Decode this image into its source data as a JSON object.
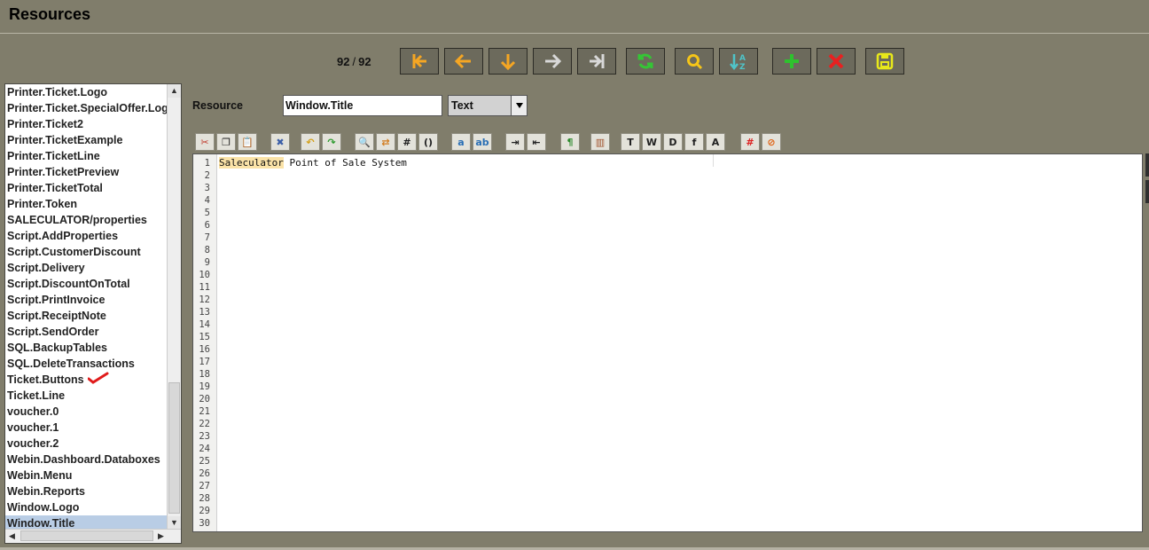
{
  "window": {
    "title": "Resources"
  },
  "record": {
    "current": "92",
    "separator": "/",
    "total": "92"
  },
  "nav_buttons": [
    {
      "name": "first-record-button",
      "icon": "first-icon",
      "color": "#f5a623"
    },
    {
      "name": "previous-record-button",
      "icon": "arrow-left-icon",
      "color": "#f5a623"
    },
    {
      "name": "down-record-button",
      "icon": "arrow-down-icon",
      "color": "#f5a623"
    },
    {
      "name": "next-record-button",
      "icon": "arrow-right-icon",
      "color": "#d8d8d8"
    },
    {
      "name": "last-record-button",
      "icon": "last-icon",
      "color": "#d8d8d8"
    },
    {
      "name": "refresh-button",
      "icon": "refresh-icon",
      "color": "#35c535"
    },
    {
      "name": "search-button",
      "icon": "search-icon",
      "color": "#f5c518"
    },
    {
      "name": "sort-button",
      "icon": "sort-az-icon",
      "color": "#4fc3c8"
    },
    {
      "name": "add-button",
      "icon": "plus-icon",
      "color": "#2ec22e"
    },
    {
      "name": "delete-button",
      "icon": "delete-x-icon",
      "color": "#e82020"
    },
    {
      "name": "save-button",
      "icon": "save-icon",
      "color": "#e8e81a"
    }
  ],
  "resource_list": {
    "items": [
      "Printer.Ticket.Logo",
      "Printer.Ticket.SpecialOffer.Logo",
      "Printer.Ticket2",
      "Printer.TicketExample",
      "Printer.TicketLine",
      "Printer.TicketPreview",
      "Printer.TicketTotal",
      "Printer.Token",
      "SALECULATOR/properties",
      "Script.AddProperties",
      "Script.CustomerDiscount",
      "Script.Delivery",
      "Script.DiscountOnTotal",
      "Script.PrintInvoice",
      "Script.ReceiptNote",
      "Script.SendOrder",
      "SQL.BackupTables",
      "SQL.DeleteTransactions",
      "Ticket.Buttons",
      "Ticket.Line",
      "voucher.0",
      "voucher.1",
      "voucher.2",
      "Webin.Dashboard.Databoxes",
      "Webin.Menu",
      "Webin.Reports",
      "Window.Logo",
      "Window.Title"
    ],
    "selected_index": 27,
    "checked_index": 18
  },
  "form": {
    "resource_label": "Resource",
    "resource_value": "Window.Title",
    "type_value": "Text"
  },
  "editor_toolbar": [
    [
      "cut-icon",
      "copy-icon",
      "paste-icon"
    ],
    [
      "clear-icon"
    ],
    [
      "undo-icon",
      "redo-icon"
    ],
    [
      "find-icon",
      "replace-icon",
      "goto-line-icon",
      "bracket-icon"
    ],
    [
      "font-smaller-icon",
      "font-bigger-icon"
    ],
    [
      "indent-icon",
      "unindent-icon"
    ],
    [
      "whitespace-icon"
    ],
    [
      "book-icon"
    ],
    [
      "text-t-icon",
      "text-w-icon",
      "text-d-icon",
      "text-f-icon",
      "text-a-icon"
    ],
    [
      "line-numbers-icon",
      "no-wrap-icon"
    ]
  ],
  "editor": {
    "highlighted_word": "Saleculator",
    "rest_of_line": " Point of Sale System",
    "line_count": 30
  }
}
